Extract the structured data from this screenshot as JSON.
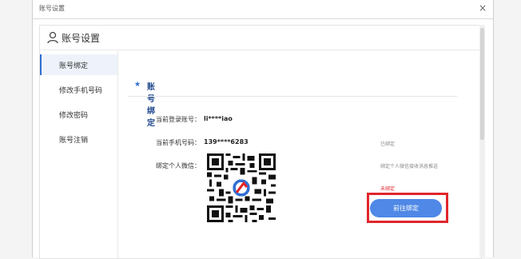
{
  "window": {
    "title": "账号设置",
    "close_glyph": "×"
  },
  "header": {
    "title": "账号设置",
    "icon": "user-icon"
  },
  "sidebar": {
    "items": [
      {
        "label": "账号绑定",
        "active": true
      },
      {
        "label": "修改手机号码",
        "active": false
      },
      {
        "label": "修改密码",
        "active": false
      },
      {
        "label": "账号注销",
        "active": false
      }
    ]
  },
  "section": {
    "star": "★",
    "title": "账号绑定",
    "login_label": "当前登录账号：",
    "login_value": "li****iao",
    "phone_label": "当前手机号码：",
    "phone_value": "139****6283",
    "phone_status": "已绑定",
    "wechat_label": "绑定个人微信：",
    "wechat_hint": "绑定个人微信接收消息推送",
    "wechat_status": "未绑定",
    "bind_button": "前往绑定"
  },
  "colors": {
    "accent": "#4f88e6",
    "highlight": "#e0262c",
    "title": "#234a8e"
  }
}
